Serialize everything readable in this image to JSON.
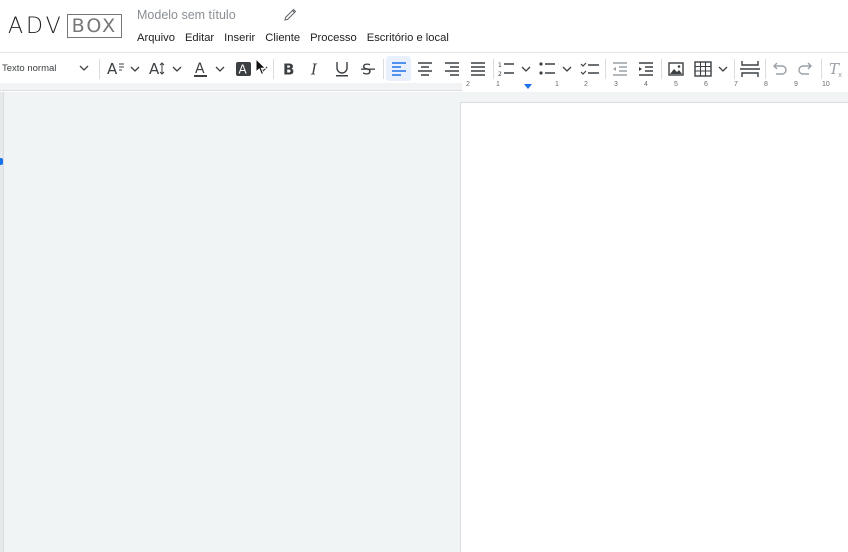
{
  "brand": {
    "adv": "ADV",
    "box": "BOX"
  },
  "document": {
    "title_placeholder": "Modelo sem título"
  },
  "menu": {
    "items": [
      "Arquivo",
      "Editar",
      "Inserir",
      "Cliente",
      "Processo",
      "Escritório e local"
    ]
  },
  "toolbar": {
    "paragraph_style": "Texto normal",
    "tools": [
      "text-style-icon",
      "font-size-icon",
      "text-color-icon",
      "highlight-color-icon",
      "bold-icon",
      "italic-icon",
      "underline-icon",
      "strikethrough-icon",
      "align-left-icon",
      "align-center-icon",
      "align-right-icon",
      "align-justify-icon",
      "numbered-list-icon",
      "bulleted-list-icon",
      "checklist-icon",
      "decrease-indent-icon",
      "increase-indent-icon",
      "insert-image-icon",
      "insert-table-icon",
      "page-break-icon",
      "undo-icon",
      "redo-icon",
      "clear-formatting-icon"
    ],
    "active_alignment": "left"
  },
  "ruler": {
    "labels": [
      "2",
      "1",
      "1",
      "2",
      "3",
      "4",
      "5",
      "6",
      "7",
      "8",
      "9",
      "10"
    ]
  },
  "colors": {
    "accent": "#1a73e8",
    "canvas": "#f1f4f5",
    "active_bg": "#e8f0fe"
  }
}
